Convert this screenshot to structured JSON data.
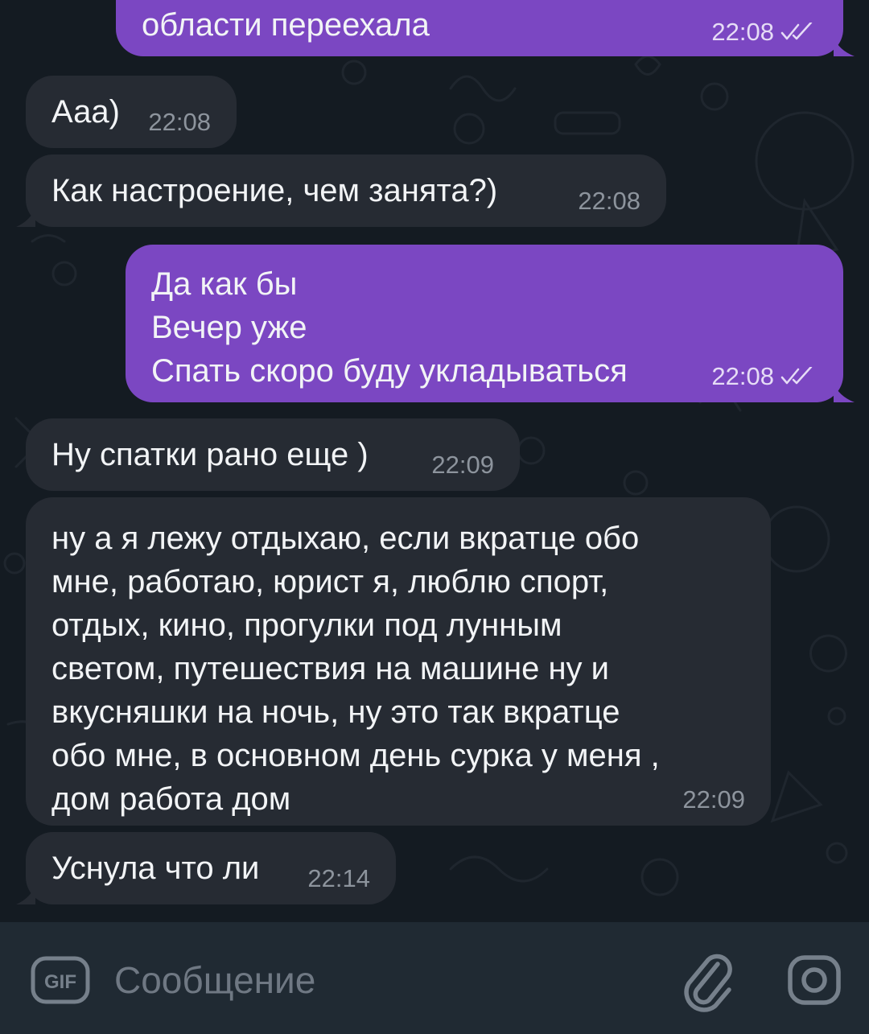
{
  "messages": [
    {
      "dir": "out",
      "text": "области переехала",
      "time": "22:08",
      "status_icon": "double-check-icon"
    },
    {
      "dir": "in",
      "text": "Ааа)",
      "time": "22:08"
    },
    {
      "dir": "in",
      "text": "Как настроение, чем занята?)",
      "time": "22:08"
    },
    {
      "dir": "out",
      "text": "Да как бы\nВечер уже\nСпать скоро буду укладываться",
      "time": "22:08",
      "status_icon": "double-check-icon"
    },
    {
      "dir": "in",
      "text": "Ну спатки рано еще )",
      "time": "22:09"
    },
    {
      "dir": "in",
      "text": "ну а я лежу отдыхаю, если вкратце обо\nмне, работаю, юрист я, люблю спорт,\nотдых, кино, прогулки под лунным\nсветом, путешествия на машине ну и\nвкусняшки на ночь, ну это так вкратце\nобо мне, в основном день сурка у меня ,\nдом работа дом",
      "time": "22:09"
    },
    {
      "dir": "in",
      "text": "Уснула что ли",
      "time": "22:14"
    }
  ],
  "composer": {
    "placeholder": "Сообщение",
    "value": "",
    "gif_icon_label": "GIF",
    "icons": [
      "gif-icon",
      "attach-icon",
      "camera-icon"
    ]
  },
  "colors": {
    "background": "#141b22",
    "incoming_bubble": "#262b33",
    "outgoing_bubble": "#7b47c2",
    "composer": "#202a33",
    "text": "#f2f4f6"
  }
}
